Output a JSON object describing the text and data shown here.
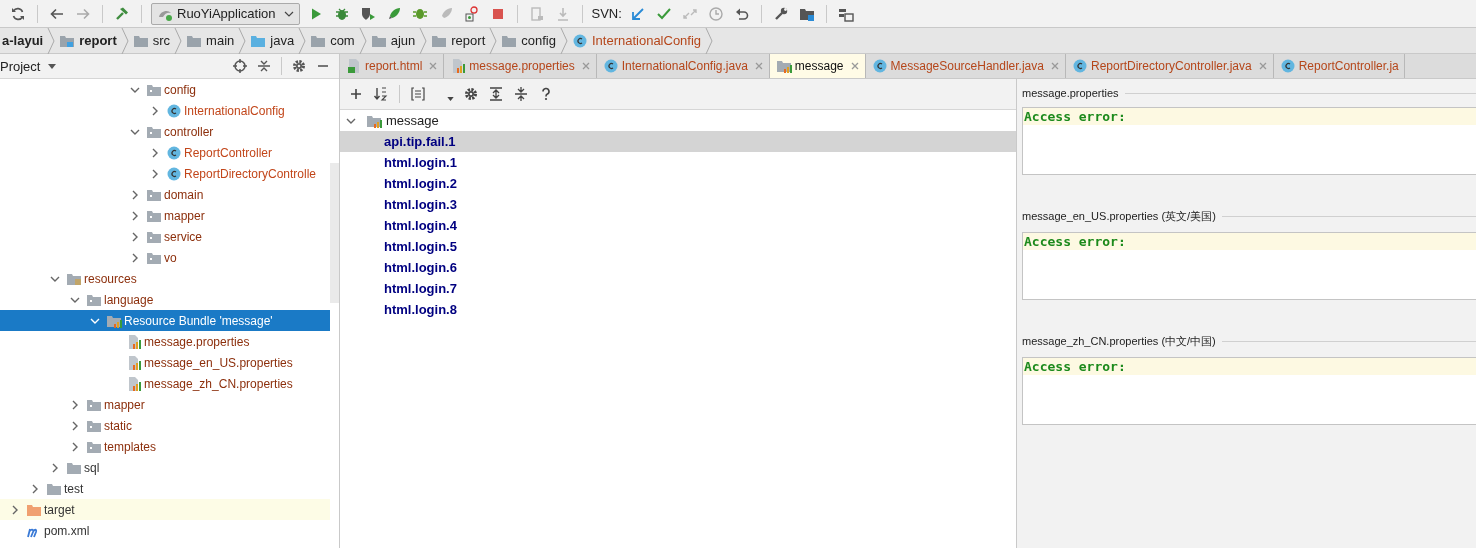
{
  "toolbar": {
    "run_config": "RuoYiApplication",
    "svn_label": "SVN:"
  },
  "breadcrumb": [
    {
      "label": "a-layui",
      "kind": "text",
      "bold": true
    },
    {
      "label": "report",
      "kind": "module",
      "bold": true
    },
    {
      "label": "src",
      "kind": "folder",
      "bold": false
    },
    {
      "label": "main",
      "kind": "folder",
      "bold": false
    },
    {
      "label": "java",
      "kind": "source-folder",
      "bold": false
    },
    {
      "label": "com",
      "kind": "folder",
      "bold": false
    },
    {
      "label": "ajun",
      "kind": "folder",
      "bold": false
    },
    {
      "label": "report",
      "kind": "folder",
      "bold": false
    },
    {
      "label": "config",
      "kind": "folder",
      "bold": false
    },
    {
      "label": "InternationalConfig",
      "kind": "class",
      "bold": false
    }
  ],
  "project_panel": {
    "title": "Project"
  },
  "project_tree": [
    {
      "children": [
        {
          "children": [
            {
              "children": [
                {
                  "children": [
                    {
                      "children": [
                        {
                          "children": [
                            {
                              "label": "config",
                              "kind": "package",
                              "expanded": true,
                              "selected": false,
                              "color": "#8c2f0c",
                              "children": [
                                {
                                  "label": "InternationalConfig",
                                  "kind": "class",
                                  "expanded": false,
                                  "selected": false,
                                  "color": "#c2461a"
                                }
                              ]
                            },
                            {
                              "label": "controller",
                              "kind": "package",
                              "expanded": true,
                              "selected": false,
                              "color": "#8c2f0c",
                              "children": [
                                {
                                  "label": "ReportController",
                                  "kind": "class",
                                  "expanded": false,
                                  "selected": false,
                                  "color": "#c2461a"
                                },
                                {
                                  "label": "ReportDirectoryControlle",
                                  "kind": "class",
                                  "expanded": false,
                                  "selected": false,
                                  "color": "#c2461a"
                                }
                              ]
                            },
                            {
                              "label": "domain",
                              "kind": "package",
                              "expanded": false,
                              "selected": false,
                              "color": "#8c2f0c"
                            },
                            {
                              "label": "mapper",
                              "kind": "package",
                              "expanded": false,
                              "selected": false,
                              "color": "#8c2f0c"
                            },
                            {
                              "label": "service",
                              "kind": "package",
                              "expanded": false,
                              "selected": false,
                              "color": "#8c2f0c"
                            },
                            {
                              "label": "vo",
                              "kind": "package",
                              "expanded": false,
                              "selected": false,
                              "color": "#8c2f0c"
                            }
                          ]
                        }
                      ]
                    }
                  ]
                }
              ]
            },
            {
              "label": "resources",
              "kind": "resources",
              "expanded": true,
              "selected": false,
              "color": "#8c2f0c",
              "children": [
                {
                  "label": "language",
                  "kind": "package",
                  "expanded": true,
                  "selected": false,
                  "color": "#8c2f0c",
                  "children": [
                    {
                      "label": "Resource Bundle 'message'",
                      "kind": "bundle",
                      "expanded": true,
                      "selected": true,
                      "children": [
                        {
                          "label": "message.properties",
                          "kind": "properties",
                          "selected": false,
                          "color": "#8c2f0c"
                        },
                        {
                          "label": "message_en_US.properties",
                          "kind": "properties",
                          "selected": false,
                          "color": "#8c2f0c"
                        },
                        {
                          "label": "message_zh_CN.properties",
                          "kind": "properties",
                          "selected": false,
                          "color": "#8c2f0c"
                        }
                      ]
                    }
                  ]
                },
                {
                  "label": "mapper",
                  "kind": "package",
                  "expanded": false,
                  "selected": false,
                  "color": "#8c2f0c"
                },
                {
                  "label": "static",
                  "kind": "package",
                  "expanded": false,
                  "selected": false,
                  "color": "#8c2f0c"
                },
                {
                  "label": "templates",
                  "kind": "package",
                  "expanded": false,
                  "selected": false,
                  "color": "#8c2f0c"
                }
              ]
            },
            {
              "label": "sql",
              "kind": "folder",
              "expanded": false,
              "selected": false,
              "color": "#333333"
            }
          ]
        },
        {
          "label": "test",
          "kind": "folder",
          "expanded": false,
          "selected": false,
          "color": "#333333"
        }
      ]
    },
    {
      "label": "target",
      "kind": "excluded",
      "expanded": false,
      "selected": false,
      "color": "#333333"
    },
    {
      "label": "pom.xml",
      "kind": "maven",
      "selected": false,
      "color": "#333333"
    }
  ],
  "editor_tabs": [
    {
      "label": "report.html",
      "kind": "html",
      "selected": false,
      "closable": true
    },
    {
      "label": "message.properties",
      "kind": "properties",
      "selected": false,
      "closable": true
    },
    {
      "label": "InternationalConfig.java",
      "kind": "class",
      "selected": false,
      "closable": true
    },
    {
      "label": "message",
      "kind": "bundle",
      "selected": true,
      "closable": true
    },
    {
      "label": "MessageSourceHandler.java",
      "kind": "class",
      "selected": false,
      "closable": true
    },
    {
      "label": "ReportDirectoryController.java",
      "kind": "class",
      "selected": false,
      "closable": true
    },
    {
      "label": "ReportController.ja",
      "kind": "class",
      "selected": false,
      "closable": false
    }
  ],
  "bundle_tree": {
    "root": {
      "label": "message",
      "expanded": true
    },
    "keys": [
      {
        "label": "api.tip.fail.1",
        "selected": true
      },
      {
        "label": "html.login.1",
        "selected": false
      },
      {
        "label": "html.login.2",
        "selected": false
      },
      {
        "label": "html.login.3",
        "selected": false
      },
      {
        "label": "html.login.4",
        "selected": false
      },
      {
        "label": "html.login.5",
        "selected": false
      },
      {
        "label": "html.login.6",
        "selected": false
      },
      {
        "label": "html.login.7",
        "selected": false
      },
      {
        "label": "html.login.8",
        "selected": false
      }
    ]
  },
  "value_sections": [
    {
      "title": "message.properties",
      "value": "Access error:"
    },
    {
      "title": "message_en_US.properties (英文/美国)",
      "value": "Access error:"
    },
    {
      "title": "message_zh_CN.properties (中文/中国)",
      "value": "Access error:"
    }
  ]
}
